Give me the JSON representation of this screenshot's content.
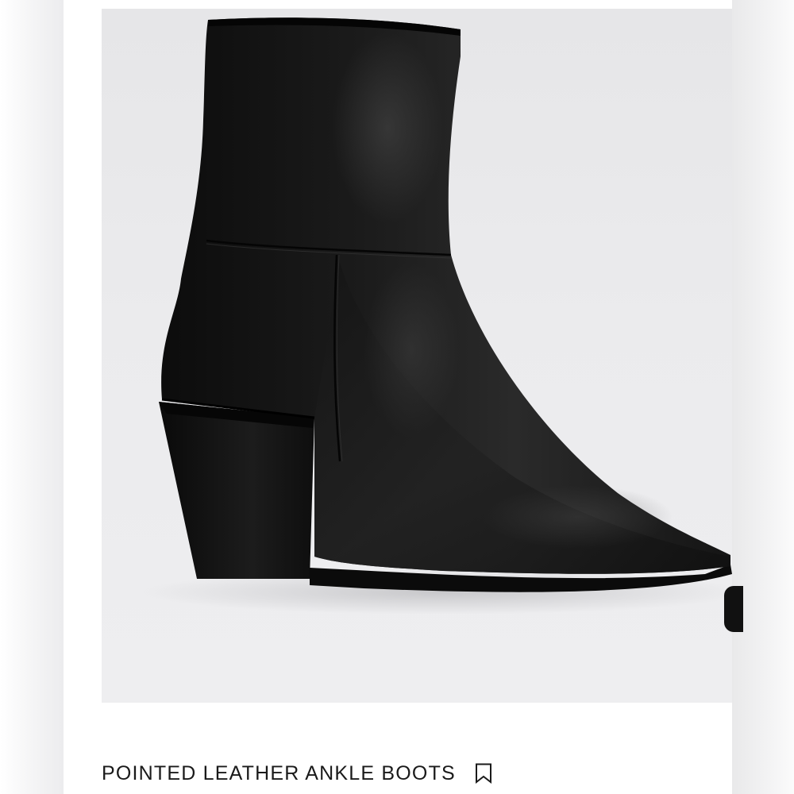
{
  "product": {
    "title": "POINTED LEATHER ANKLE BOOTS",
    "image_subject": "black leather pointed-toe ankle boot with block heel"
  },
  "icons": {
    "save": "bookmark-icon",
    "next": "next-image-arrow-icon"
  },
  "colors": {
    "page_background": "#ffffff",
    "photo_background": "#eaeaec",
    "boot": "#141414",
    "text": "#1a1a1a"
  }
}
